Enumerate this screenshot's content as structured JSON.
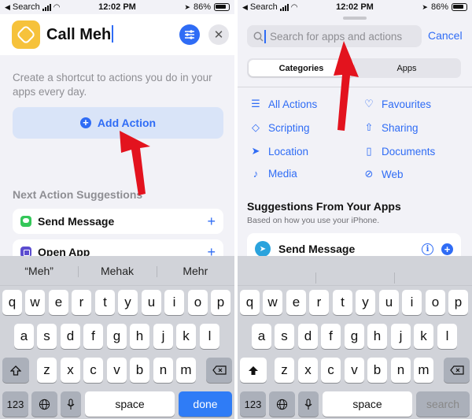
{
  "status_bar": {
    "back_label": "Search",
    "time": "12:02 PM",
    "battery": "86%"
  },
  "left": {
    "shortcut_name": "Call Meh",
    "icon_names": {
      "app": "shortcut-layers-icon",
      "settings": "sliders-icon",
      "close": "close-icon"
    },
    "close_glyph": "✕",
    "intro_text": "Create a shortcut to actions you do in your apps every day.",
    "add_action_label": "Add Action",
    "suggestions_title": "Next Action Suggestions",
    "suggestions": [
      {
        "label": "Send Message",
        "icon": "messages-icon"
      },
      {
        "label": "Open App",
        "icon": "open-app-icon"
      }
    ],
    "add_glyph": "+"
  },
  "right": {
    "search_placeholder": "Search for apps and actions",
    "cancel_label": "Cancel",
    "segments": {
      "categories": "Categories",
      "apps": "Apps"
    },
    "categories": [
      {
        "label": "All Actions",
        "icon": "list-icon"
      },
      {
        "label": "Favourites",
        "icon": "heart-icon"
      },
      {
        "label": "Scripting",
        "icon": "scripting-icon"
      },
      {
        "label": "Sharing",
        "icon": "share-icon"
      },
      {
        "label": "Location",
        "icon": "location-arrow-icon"
      },
      {
        "label": "Documents",
        "icon": "document-icon"
      },
      {
        "label": "Media",
        "icon": "music-note-icon"
      },
      {
        "label": "Web",
        "icon": "compass-icon"
      }
    ],
    "suggestions_title": "Suggestions From Your Apps",
    "suggestions_subtitle": "Based on how you use your iPhone.",
    "app_suggestion": {
      "label": "Send Message",
      "app_icon": "telegram-icon"
    }
  },
  "keyboard_left": {
    "predictions": [
      "“Meh”",
      "Mehak",
      "Mehr"
    ],
    "row1": [
      "q",
      "w",
      "e",
      "r",
      "t",
      "y",
      "u",
      "i",
      "o",
      "p"
    ],
    "row2": [
      "a",
      "s",
      "d",
      "f",
      "g",
      "h",
      "j",
      "k",
      "l"
    ],
    "row3": [
      "z",
      "x",
      "c",
      "v",
      "b",
      "n",
      "m"
    ],
    "numbers_label": "123",
    "space_label": "space",
    "return_label": "done"
  },
  "keyboard_right": {
    "row1": [
      "q",
      "w",
      "e",
      "r",
      "t",
      "y",
      "u",
      "i",
      "o",
      "p"
    ],
    "row2": [
      "a",
      "s",
      "d",
      "f",
      "g",
      "h",
      "j",
      "k",
      "l"
    ],
    "row3": [
      "z",
      "x",
      "c",
      "v",
      "b",
      "n",
      "m"
    ],
    "numbers_label": "123",
    "space_label": "space",
    "return_label": "search"
  },
  "colors": {
    "accent": "#2f6cf5",
    "app_icon": "#f6c23b",
    "annotation_arrow": "#e3131e",
    "keyboard_bg": "#d1d3d9"
  }
}
